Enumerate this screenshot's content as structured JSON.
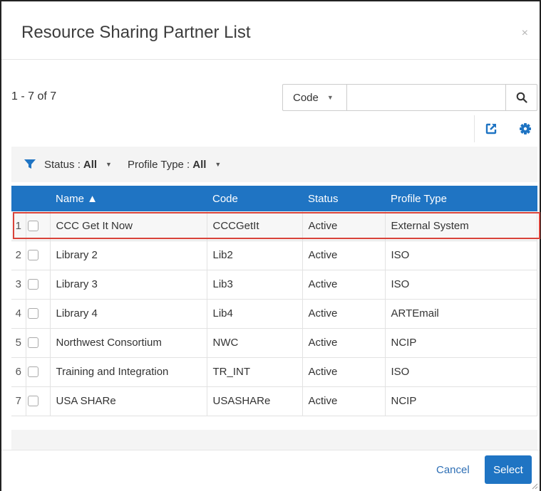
{
  "dialog": {
    "title": "Resource Sharing Partner List",
    "close_glyph": "×"
  },
  "results": {
    "count": "1 - 7 of 7"
  },
  "search": {
    "field_label": "Code",
    "value": "",
    "placeholder": "",
    "icon": "search-icon"
  },
  "toolbar": {
    "export_icon": "external-link-icon",
    "settings_icon": "gear-icon"
  },
  "filters": [
    {
      "label": "Status :",
      "value": "All"
    },
    {
      "label": "Profile Type :",
      "value": "All"
    }
  ],
  "table": {
    "columns": [
      "Name ▲",
      "Code",
      "Status",
      "Profile Type"
    ],
    "rows": [
      {
        "num": "1",
        "name": "CCC Get It Now",
        "code": "CCCGetIt",
        "status": "Active",
        "profile": "External System"
      },
      {
        "num": "2",
        "name": "Library 2",
        "code": "Lib2",
        "status": "Active",
        "profile": "ISO"
      },
      {
        "num": "3",
        "name": "Library 3",
        "code": "Lib3",
        "status": "Active",
        "profile": "ISO"
      },
      {
        "num": "4",
        "name": "Library 4",
        "code": "Lib4",
        "status": "Active",
        "profile": "ARTEmail"
      },
      {
        "num": "5",
        "name": "Northwest Consortium",
        "code": "NWC",
        "status": "Active",
        "profile": "NCIP"
      },
      {
        "num": "6",
        "name": "Training and Integration",
        "code": "TR_INT",
        "status": "Active",
        "profile": "ISO"
      },
      {
        "num": "7",
        "name": "USA SHARe",
        "code": "USASHARe",
        "status": "Active",
        "profile": "NCIP"
      }
    ]
  },
  "footer": {
    "cancel_label": "Cancel",
    "select_label": "Select"
  },
  "colors": {
    "accent": "#1f74c3",
    "highlight_border": "#d9433a"
  }
}
